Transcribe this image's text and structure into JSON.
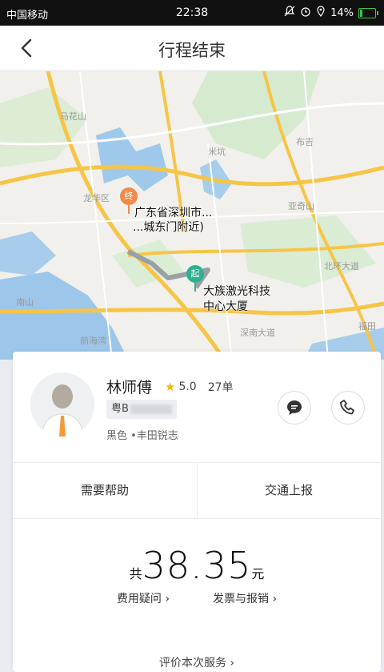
{
  "status_bar": {
    "carrier": "中国移动",
    "time": "22:38",
    "battery": "14%",
    "battery_level": 0.14
  },
  "nav": {
    "title": "行程结束"
  },
  "map": {
    "end_marker": "终",
    "end_label_1": "广东省深圳市...",
    "end_label_2": "...城东门附近)",
    "start_marker": "起",
    "start_label_1": "大族激光科技",
    "start_label_2": "中心大厦",
    "place_labels": [
      "马花山",
      "龙华区",
      "米坑",
      "布吉",
      "亚奇山",
      "北环大道",
      "深南大道",
      "福田",
      "前海湾",
      "南山"
    ]
  },
  "driver": {
    "name": "林师傅",
    "rating": "5.0",
    "orders": "27单",
    "plate_prefix": "粤B",
    "car": "黑色 •丰田锐志"
  },
  "actions": {
    "help": "需要帮助",
    "report": "交通上报"
  },
  "fare": {
    "prefix": "共",
    "amount": "38.35",
    "unit": "元"
  },
  "links": {
    "question": "费用疑问 ›",
    "invoice": "发票与报销 ›"
  },
  "rate_service": "评价本次服务 ›",
  "colors": {
    "end_pin": "#f08a4b",
    "start_pin": "#2fb08f",
    "route": "#9aa0a6"
  }
}
